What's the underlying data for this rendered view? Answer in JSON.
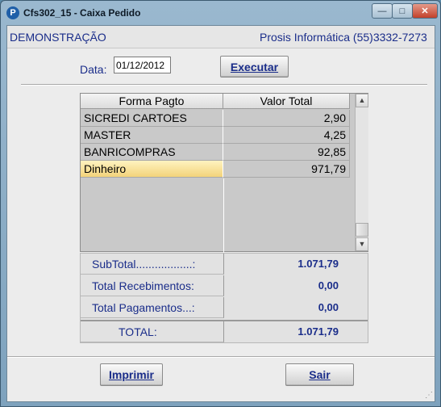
{
  "window": {
    "title": "Cfs302_15 - Caixa Pedido",
    "app_icon_letter": "P"
  },
  "header": {
    "left": "DEMONSTRAÇÃO",
    "right": "Prosis Informática (55)3332-7273"
  },
  "filter": {
    "date_label": "Data:",
    "date_value": "01/12/2012",
    "execute_label": "Executar"
  },
  "grid": {
    "columns": [
      "Forma Pagto",
      "Valor Total"
    ],
    "rows": [
      {
        "forma": "SICREDI CARTOES",
        "valor": "2,90"
      },
      {
        "forma": "MASTER",
        "valor": "4,25"
      },
      {
        "forma": "BANRICOMPRAS",
        "valor": "92,85"
      },
      {
        "forma": "Dinheiro",
        "valor": "971,79"
      }
    ]
  },
  "totals": {
    "subtotal_label": "SubTotal..................:",
    "subtotal_value": "1.071,79",
    "recebimentos_label": "Total Recebimentos:",
    "recebimentos_value": "0,00",
    "pagamentos_label": "Total Pagamentos...:",
    "pagamentos_value": "0,00",
    "total_label": "TOTAL:",
    "total_value": "1.071,79"
  },
  "actions": {
    "print_label": "Imprimir",
    "exit_label": "Sair"
  }
}
